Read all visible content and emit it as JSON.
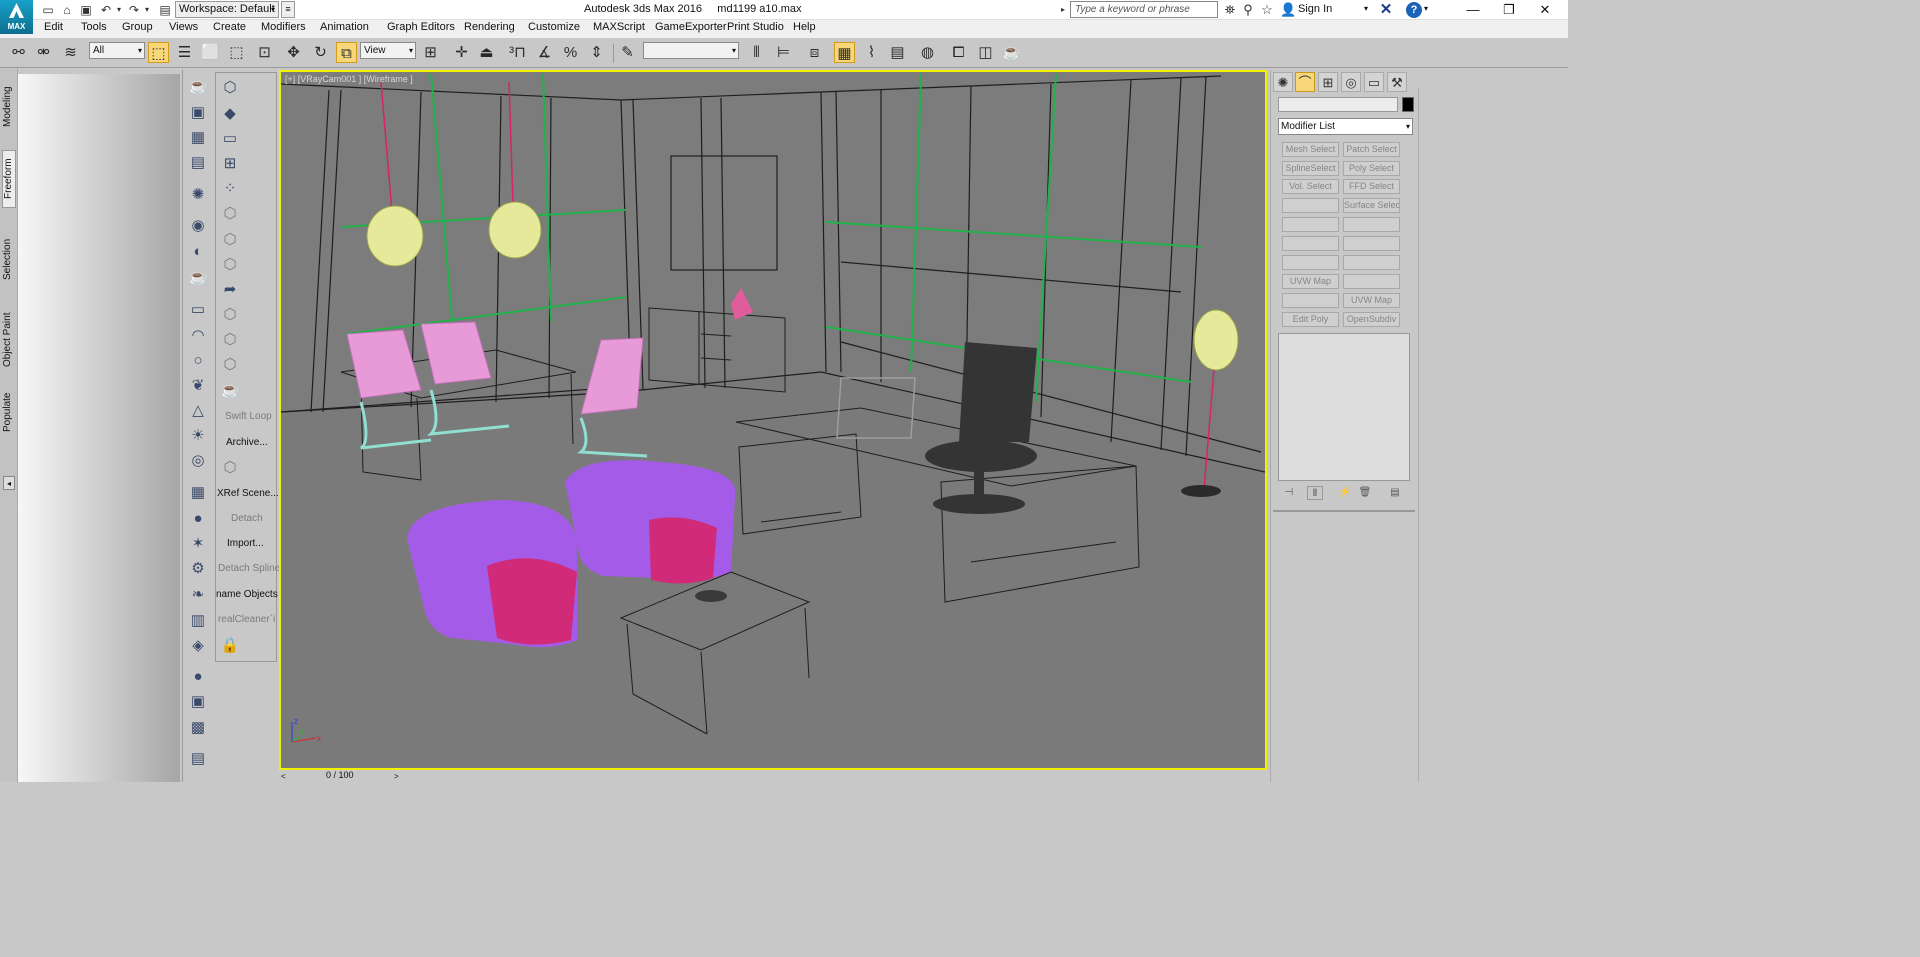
{
  "window": {
    "title": "Autodesk 3ds Max 2016     md1199 a10.max",
    "app_logo_text": "MAX",
    "workspace": "Workspace: Default",
    "search_placeholder": "Type a keyword or phrase",
    "sign_in": "Sign In"
  },
  "menu": [
    "Edit",
    "Tools",
    "Group",
    "Views",
    "Create",
    "Modifiers",
    "Animation",
    "Graph Editors",
    "Rendering",
    "Customize",
    "MAXScript",
    "GameExporter",
    "Print Studio",
    "Help"
  ],
  "toolbar": {
    "selection_filter": "All",
    "reference_coord": "View",
    "named_selection": ""
  },
  "ribbon_tabs": [
    "Modeling",
    "Freeform",
    "Selection",
    "Object Paint",
    "Populate"
  ],
  "command_column": {
    "labels": [
      "Swift Loop",
      "Archive...",
      "XRef Scene...",
      "Detach",
      "Import...",
      "Detach Spline",
      "name Objects",
      "realCleaner`i"
    ]
  },
  "viewport": {
    "label": "[+] [VRayCam001 ] [Wireframe ]",
    "axis_labels": [
      "x",
      "y",
      "z"
    ]
  },
  "timeslider": {
    "label": "0 / 100"
  },
  "command_panel": {
    "modifier_list": "Modifier List",
    "buttons": [
      [
        "Mesh Select",
        "Patch Select"
      ],
      [
        "SplineSelect",
        "Poly Select"
      ],
      [
        "Vol. Select",
        "FFD Select"
      ],
      [
        "",
        "Surface Select"
      ],
      [
        "",
        ""
      ],
      [
        "",
        ""
      ],
      [
        "",
        ""
      ],
      [
        "UVW Map",
        ""
      ],
      [
        "",
        "UVW Map"
      ],
      [
        "Edit Poly",
        "OpenSubdiv"
      ]
    ]
  }
}
